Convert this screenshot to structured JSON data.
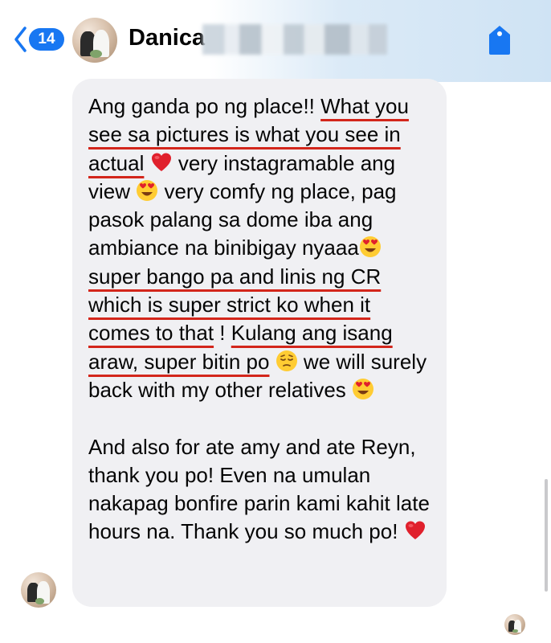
{
  "header": {
    "unread_count": "14",
    "contact_name": "Danica"
  },
  "message": {
    "p1_text_a": "Ang ganda po ng place!! ",
    "p1_u1": "What you see sa pictures is what you see in actual",
    "p1_text_b": " very instagramable ang view ",
    "p1_text_c": " very comfy ng place, pag pasok palang sa dome iba ang ambiance na binibigay nyaaa",
    "p1_u2": "super bango pa and linis ng CR which is super strict ko when it comes to that",
    "p1_text_d": " ! ",
    "p1_u3": "Kulang ang isang araw, super bitin po",
    "p1_text_e": " ",
    "p1_text_f": " we will surely back with my other relatives ",
    "p2_text": "And also for ate amy and ate Reyn, thank you po! Even na umulan nakapag bonfire parin kami kahit late hours na. Thank you so much po! "
  },
  "icons": {
    "back": "chevron-left-icon",
    "tag": "tag-icon",
    "heart": "red-heart-emoji",
    "heart_eyes": "heart-eyes-emoji",
    "pensive": "pensive-face-emoji"
  },
  "colors": {
    "accent": "#1877f2",
    "underline": "#d3261b",
    "bubble": "#f0f0f3"
  }
}
